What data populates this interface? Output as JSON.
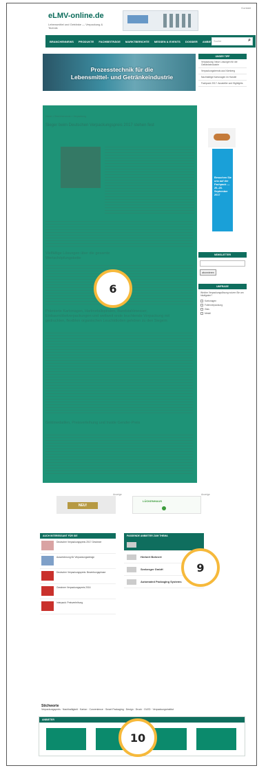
{
  "header": {
    "logo": "eLMV-online.de",
    "tagline": "Lebensmittel und Getränke — Verpackung & Technik",
    "top_link": "Kontakt"
  },
  "nav": {
    "items": [
      "BRANCHENNEWS",
      "PRODUKTE",
      "FACHBEITRÄGE",
      "MARKTBERICHTE",
      "MESSEN & EVENTS",
      "DOSSIER",
      "ANBIETERLISTE"
    ],
    "search_placeholder": "Suche"
  },
  "banner": {
    "line1": "Prozesstechnik für die",
    "line2": "Lebensmittel- und Getränkeindustrie"
  },
  "article": {
    "breadcrumb": "Home > Branchennews > Verpackung",
    "title": "Sieger beim Deutschen Verpackungspreis 2017 stehen fest",
    "subheads": [
      "Vielfältige Lösungen über die gesamte Wertschöpfungskette",
      "Prämierte Kartonagen, Hartmetallspiralen, Bandstahlmesser, Einbaumöbelverpackungen und weltweit erste leuchtende Verpackung mit gedruckten, flexiblen organischen Leuchtdioden gehören zu den Siegern",
      "Goldmedaillen, Preisverleihung und Inside Gender-Preis"
    ]
  },
  "badges": {
    "article": "6",
    "supplier": "9",
    "bottom": "10"
  },
  "sidebar": {
    "head": "UNSER TIPP",
    "items": [
      "Verpackung: Neue Lösungen für die Getränkeindustrie",
      "Verpackungstrends aus Nürnberg",
      "Nachhaltige Kartonagen im Handel",
      "Fachpack 2017: Aussteller und Highlights"
    ],
    "newsletter_head": "NEWSLETTER",
    "newsletter_btn": "abonnieren",
    "poll_head": "UMFRAGE",
    "poll_question": "Welche Verpackungslösung nutzen Sie am häufigsten?",
    "poll_options": [
      "Kartonagen",
      "Folienverpackung",
      "Glas",
      "Metall"
    ]
  },
  "side_ad": {
    "text": "Besuchen Sie uns auf der Fachpack — 26.-28. September 2017"
  },
  "ads": {
    "left": "NEU!",
    "right": "LÜCKENHAUS",
    "tag": "Anzeige"
  },
  "interest": {
    "head": "AUCH INTERESSANT FÜR SIE",
    "items": [
      "Deutscher Verpackungspreis 2017 Gewinner",
      "Auszeichnung für Verpackungsdesign",
      "Deutscher Verpackungspreis: Bewerbungsphase",
      "Gewinner Verpackungspreis 2016",
      "Interpack: Preisverleihung"
    ]
  },
  "supplier": {
    "head": "PASSENDE ANBIETER ZUM THEMA",
    "items": [
      "",
      "Herbert Bohnert",
      "Seeberger GmbH",
      "Automated Packaging Systems"
    ]
  },
  "tags": {
    "head": "Stichworte",
    "text": "Verpackungspreis · Nachhaltigkeit · Karton · Convenience · Smart Packaging · Design · Druck · OLED · Verpackungsinstitut"
  },
  "bottom": {
    "head": "ANBIETER"
  }
}
